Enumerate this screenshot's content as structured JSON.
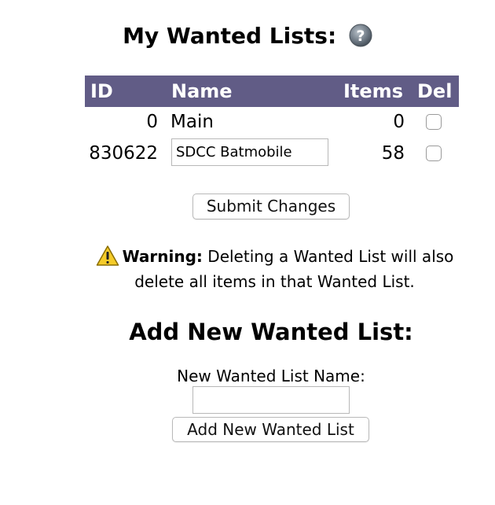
{
  "page_title": "My Wanted Lists:",
  "table": {
    "headers": {
      "id": "ID",
      "name": "Name",
      "items": "Items",
      "del": "Del"
    },
    "rows": [
      {
        "id": "0",
        "name": "Main",
        "items": "0",
        "deletable": false
      },
      {
        "id": "830622",
        "name": "SDCC Batmobile",
        "items": "58",
        "deletable": false
      }
    ]
  },
  "submit_label": "Submit Changes",
  "warning": {
    "label": "Warning:",
    "text": " Deleting a Wanted List will also delete all items in that Wanted List."
  },
  "add_section": {
    "title": "Add New Wanted List:",
    "field_label": "New Wanted List Name:",
    "field_value": "",
    "button_label": "Add New Wanted List"
  },
  "icons": {
    "help": "help-icon",
    "warning": "warning-icon"
  },
  "colors": {
    "header_bg": "#615c86",
    "header_text": "#ffffff"
  }
}
